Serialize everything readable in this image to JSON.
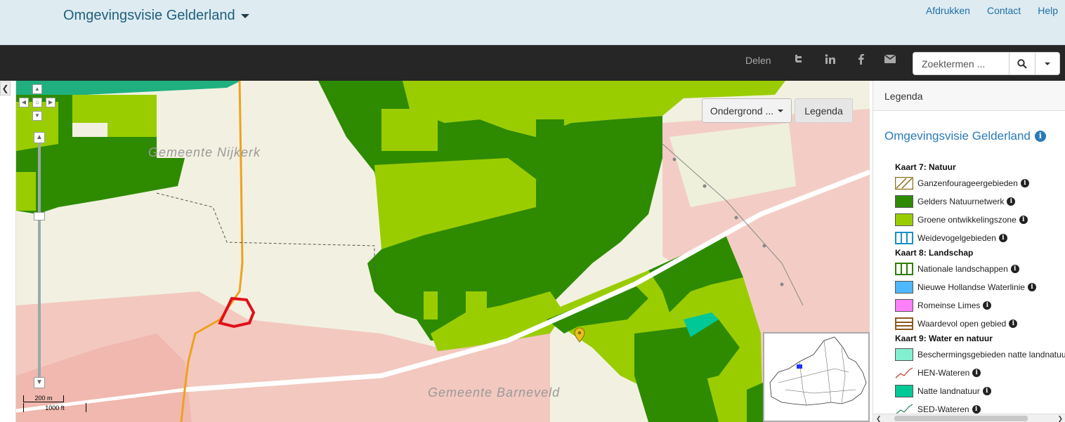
{
  "header": {
    "title": "Omgevingsvisie Gelderland",
    "links": [
      "Afdrukken",
      "Contact",
      "Help"
    ]
  },
  "toolbar": {
    "share_label": "Delen",
    "share_icons": [
      "twitter-icon",
      "linkedin-icon",
      "facebook-icon",
      "mail-icon"
    ],
    "search": {
      "placeholder": "Zoektermen ...",
      "value": ""
    }
  },
  "map": {
    "basemap_button": "Ondergrond ...",
    "legend_button": "Legenda",
    "labels": [
      "Gemeente  Nijkerk",
      "Gemeente  Barneveld"
    ],
    "scale": {
      "metric": "200 m",
      "imperial": "1000 ft"
    }
  },
  "legend": {
    "header": "Legenda",
    "title": "Omgevingsvisie Gelderland",
    "sections": [
      {
        "title": "Kaart 7: Natuur",
        "items": [
          {
            "label": "Ganzenfourageergebieden",
            "pattern": "hatch",
            "color": "#8b6f1e"
          },
          {
            "label": "Gelders Natuurnetwerk",
            "pattern": "fill",
            "color": "#2e8b00"
          },
          {
            "label": "Groene ontwikkelingszone",
            "pattern": "fill",
            "color": "#9acd00"
          },
          {
            "label": "Weidevogelgebieden",
            "pattern": "vlines",
            "color": "#1b8fc2"
          }
        ]
      },
      {
        "title": "Kaart 8: Landschap",
        "items": [
          {
            "label": "Nationale landschappen",
            "pattern": "vlines",
            "color": "#2e7d00"
          },
          {
            "label": "Nieuwe Hollandse Waterlinie",
            "pattern": "fill",
            "color": "#4db8ff"
          },
          {
            "label": "Romeinse Limes",
            "pattern": "fill",
            "color": "#ff80ff"
          },
          {
            "label": "Waardevol open gebied",
            "pattern": "hlines",
            "color": "#8b5a1e"
          }
        ]
      },
      {
        "title": "Kaart 9: Water en natuur",
        "items": [
          {
            "label": "Beschermingsgebieden natte landnatuur",
            "pattern": "fill",
            "color": "#80f0d0"
          },
          {
            "label": "HEN-Wateren",
            "pattern": "line",
            "color": "#c0392b"
          },
          {
            "label": "Natte landnatuur",
            "pattern": "fill",
            "color": "#00c896"
          },
          {
            "label": "SED-Wateren",
            "pattern": "line",
            "color": "#2e8b57"
          }
        ]
      }
    ]
  }
}
